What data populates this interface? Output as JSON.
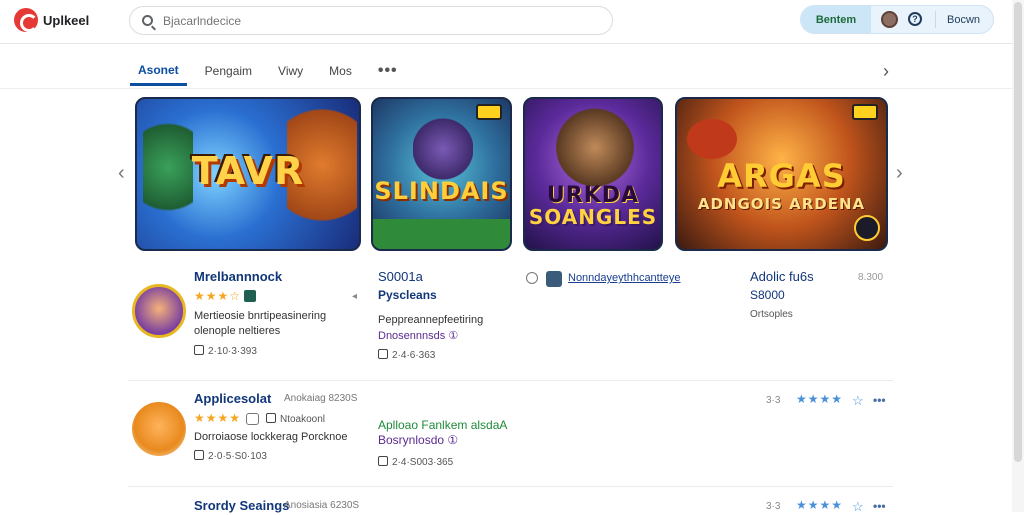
{
  "app": {
    "logo_text": "Uplkeel",
    "search_placeholder": "Bjacarlndecice"
  },
  "header_actions": {
    "primary_label": "Bentem",
    "help_icon": "?",
    "account_label": "Bocwn"
  },
  "tabs": [
    {
      "label": "Asonet",
      "active": true
    },
    {
      "label": "Pengaim",
      "active": false
    },
    {
      "label": "Viwy",
      "active": false
    },
    {
      "label": "Mos",
      "active": false
    }
  ],
  "tabs_more": "•••",
  "carousel": {
    "prev_icon": "‹",
    "next_icon": "›",
    "tabs_next_icon": "›",
    "banners": [
      {
        "title": "TAVR",
        "subtitle": "TAVR"
      },
      {
        "title": "SLINDAIS",
        "subtitle": ""
      },
      {
        "title": "URKDA",
        "subtitle": "SOANGLES"
      },
      {
        "title": "ARGAS",
        "subtitle": "ADNGOIS ARDENA"
      }
    ]
  },
  "featured": {
    "left": {
      "title": "Mrelbannnock",
      "stars": "★★★☆",
      "desc_line1": "Mertieosie bnrtipeasinering",
      "desc_line2": "olenople neltieres",
      "meta": "2·10·3·393",
      "right_mark": "◂"
    },
    "middle": {
      "title": "S0001a",
      "subtitle": "Pyscleans",
      "desc_line1": "Peppreannepfeetiring",
      "desc_line2": "Dnosennnsds ①",
      "meta": "2·4·6·363"
    },
    "link": {
      "text": "Nonndayeythhcantteye"
    },
    "right": {
      "title": "Adolic fu6s",
      "subtitle": "S8000",
      "caption": "Ortsoples",
      "code": "8.300"
    }
  },
  "list": [
    {
      "title": "Applicesolat",
      "secondary": "Anokaiag 8230S",
      "stars": "★★★★",
      "tag": "Ntoakoonl",
      "desc_line1": "Dorroiaose lockkerag Porcknoe",
      "desc_line2": "2·0·5·S0·103",
      "green_line": "Aplloao Fanlkem alsdaA",
      "purple_line": "Bosrynlosdo ①",
      "meta": "2·4·S003·365",
      "right_num": "3·3",
      "right_stars": "★★★★",
      "right_more": "•••"
    },
    {
      "title": "Srordy Seaings",
      "secondary": "Anosiasia 6230S",
      "right_num": "3·3",
      "right_stars": "★★★★",
      "right_more": "•••"
    }
  ]
}
